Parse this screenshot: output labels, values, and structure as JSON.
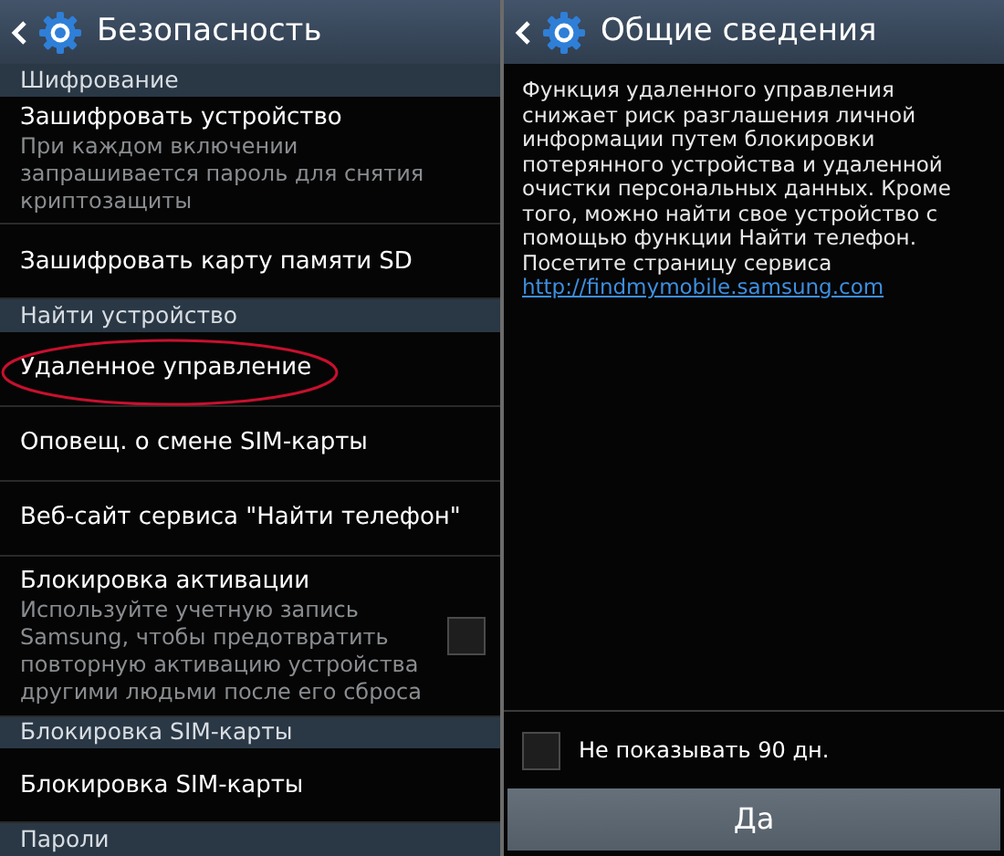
{
  "left": {
    "title": "Безопасность",
    "rows": [
      {
        "kind": "section",
        "title": "Шифрование"
      },
      {
        "kind": "item",
        "title": "Зашифровать устройство",
        "summary": "При каждом включении запрашивается пароль для снятия криптозащиты",
        "highlighted": false
      },
      {
        "kind": "item",
        "title": "Зашифровать карту памяти SD",
        "highlighted": false
      },
      {
        "kind": "section",
        "title": "Найти устройство"
      },
      {
        "kind": "item",
        "title": "Удаленное управление",
        "highlighted": true
      },
      {
        "kind": "item",
        "title": "Оповещ. о смене SIM-карты",
        "highlighted": false
      },
      {
        "kind": "item",
        "title": "Веб-сайт сервиса \"Найти телефон\"",
        "highlighted": false
      },
      {
        "kind": "checkbox",
        "title": "Блокировка активации",
        "summary": "Используйте учетную запись Samsung, чтобы предотвратить повторную активацию устройства другими людьми после его сброса",
        "checked": false
      },
      {
        "kind": "section",
        "title": "Блокировка SIM-карты"
      },
      {
        "kind": "item",
        "title": "Блокировка SIM-карты",
        "highlighted": false
      },
      {
        "kind": "section",
        "title": "Пароли"
      }
    ]
  },
  "right": {
    "title": "Общие сведения",
    "body": "Функция удаленного управления снижает риск разглашения личной информации путем блокировки потерянного устройства и удаленной очистки персональных данных. Кроме того, можно найти свое устройство с помощью функции Найти телефон. Посетите страницу сервиса",
    "link": "http://findmymobile.samsung.com",
    "dont_show": {
      "label": "Не показывать 90 дн.",
      "checked": false
    },
    "button": "Да"
  }
}
